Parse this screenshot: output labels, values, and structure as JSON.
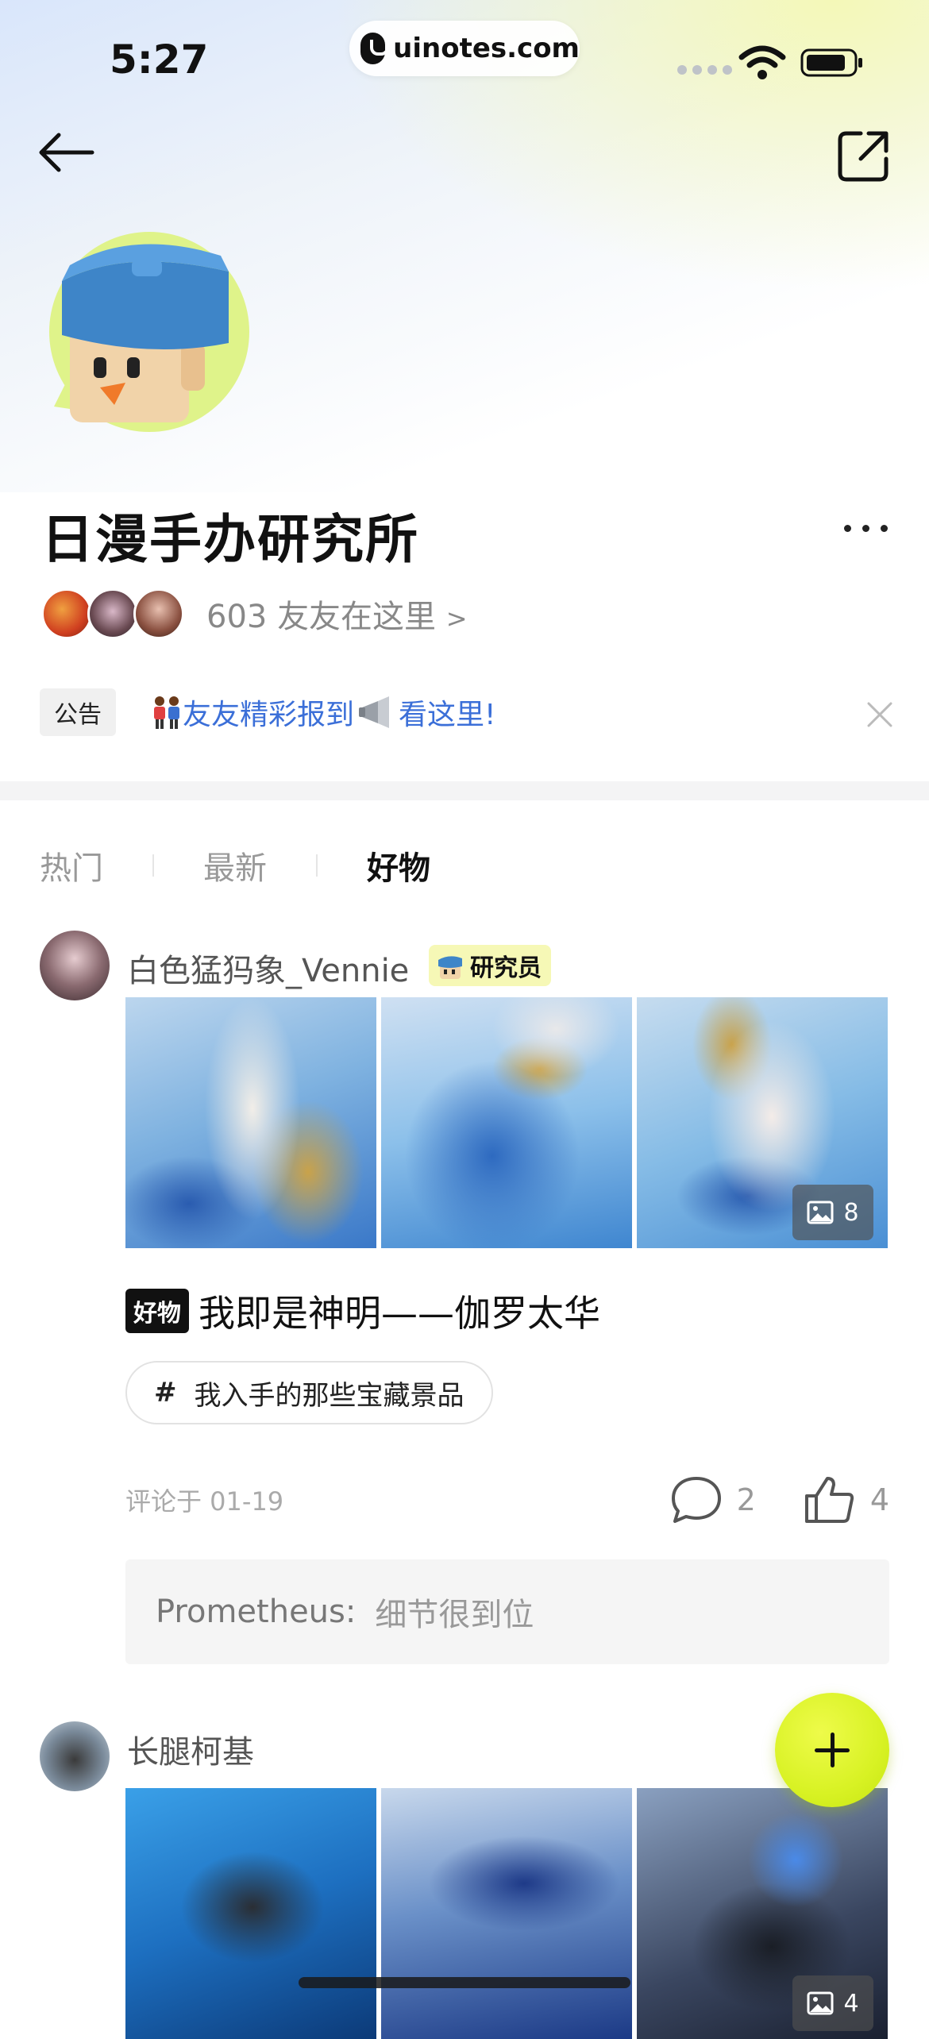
{
  "status_bar": {
    "time": "5:27",
    "url": "uinotes.com"
  },
  "group": {
    "title": "日漫手办研究所",
    "member_count_text": "603 友友在这里",
    "member_chevron": ">"
  },
  "notice": {
    "tag": "公告",
    "text_part1": "友友精彩报到",
    "text_part2": "看这里!"
  },
  "tabs": [
    {
      "label": "热门",
      "active": false
    },
    {
      "label": "最新",
      "active": false
    },
    {
      "label": "好物",
      "active": true
    }
  ],
  "posts": [
    {
      "author": "白色猛犸象_Vennie",
      "badge": "研究员",
      "image_count": "8",
      "title_tag": "好物",
      "title": "我即是神明——伽罗太华",
      "topic_hash": "#",
      "topic": "我入手的那些宝藏景品",
      "time": "评论于 01-19",
      "comments": "2",
      "likes": "4",
      "top_comment": {
        "name": "Prometheus:",
        "text": "细节很到位"
      }
    },
    {
      "author": "长腿柯基",
      "image_count": "4"
    }
  ],
  "colors": {
    "accent_yellow": "#d8f224",
    "link_blue": "#3b6fd8",
    "badge_bg": "#f6f8b6"
  },
  "icons": [
    "back-arrow-icon",
    "share-icon",
    "more-icon",
    "close-icon",
    "image-icon",
    "comment-icon",
    "like-icon",
    "plus-icon"
  ]
}
